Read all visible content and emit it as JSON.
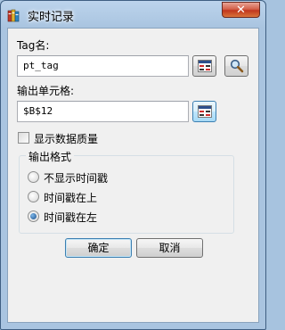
{
  "window": {
    "title": "实时记录",
    "app_icon": "books-icon",
    "close_label": "✕"
  },
  "tag": {
    "label": "Tag名:",
    "value": "pt_tag",
    "pick_icon": "tag-picker-icon",
    "search_icon": "magnifier-icon"
  },
  "output_cell": {
    "label": "输出单元格:",
    "value": "$B$12",
    "pick_icon": "cell-picker-icon"
  },
  "show_quality": {
    "label": "显示数据质量",
    "checked": false
  },
  "output_format": {
    "legend": "输出格式",
    "options": [
      {
        "label": "不显示时间戳",
        "selected": false
      },
      {
        "label": "时间戳在上",
        "selected": false
      },
      {
        "label": "时间戳在左",
        "selected": true
      }
    ]
  },
  "buttons": {
    "ok": "确定",
    "cancel": "取消"
  },
  "colors": {
    "frame": "#a9c4e0",
    "client": "#f0f0f0",
    "close": "#c1361e",
    "focus": "#3c7fb1"
  }
}
